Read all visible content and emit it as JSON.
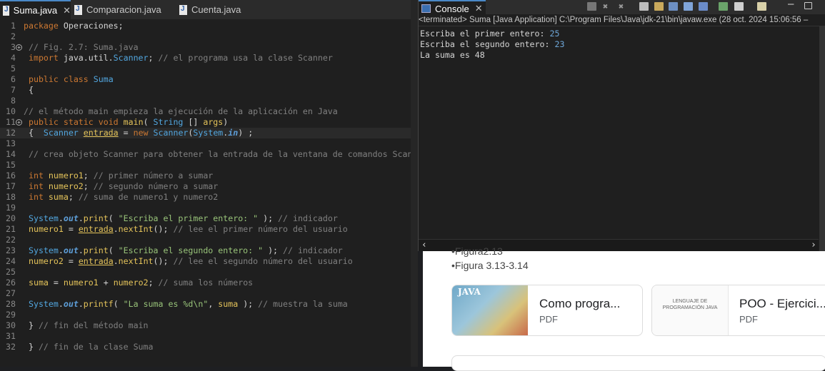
{
  "editor": {
    "tabs": [
      {
        "label": "Suma.java",
        "close": "✕",
        "active": true
      },
      {
        "label": "Comparacion.java",
        "active": false
      },
      {
        "label": "Cuenta.java",
        "active": false
      }
    ],
    "lines": [
      {
        "n": "1",
        "t": "package Operaciones;"
      },
      {
        "n": "2",
        "t": ""
      },
      {
        "n": "3",
        "t": " // Fig. 2.7: Suma.java"
      },
      {
        "n": "4",
        "t": " import java.util.Scanner; // el programa usa la clase Scanner"
      },
      {
        "n": "5",
        "t": ""
      },
      {
        "n": "6",
        "t": " public class Suma"
      },
      {
        "n": "7",
        "t": " {"
      },
      {
        "n": "8",
        "t": ""
      },
      {
        "n": "10",
        "t": "// el método main empieza la ejecución de la aplicación en Java"
      },
      {
        "n": "11",
        "t": " public static void main( String [] args)"
      },
      {
        "n": "12",
        "t": " {  Scanner entrada = new Scanner(System.in) ;"
      },
      {
        "n": "13",
        "t": ""
      },
      {
        "n": "14",
        "t": " // crea objeto Scanner para obtener la entrada de la ventana de comandos Scan"
      },
      {
        "n": "15",
        "t": ""
      },
      {
        "n": "16",
        "t": " int numero1; // primer número a sumar"
      },
      {
        "n": "17",
        "t": " int numero2; // segundo número a sumar"
      },
      {
        "n": "18",
        "t": " int suma; // suma de numero1 y numero2"
      },
      {
        "n": "19",
        "t": ""
      },
      {
        "n": "20",
        "t": " System.out.print( \"Escriba el primer entero: \" ); // indicador"
      },
      {
        "n": "21",
        "t": " numero1 = entrada.nextInt(); // lee el primer número del usuario"
      },
      {
        "n": "22",
        "t": ""
      },
      {
        "n": "23",
        "t": " System.out.print( \"Escriba el segundo entero: \" ); // indicador"
      },
      {
        "n": "24",
        "t": " numero2 = entrada.nextInt(); // lee el segundo número del usuario"
      },
      {
        "n": "25",
        "t": ""
      },
      {
        "n": "26",
        "t": " suma = numero1 + numero2; // suma los números"
      },
      {
        "n": "27",
        "t": ""
      },
      {
        "n": "28",
        "t": " System.out.printf( \"La suma es %d\\n\", suma ); // muestra la suma"
      },
      {
        "n": "29",
        "t": ""
      },
      {
        "n": "30",
        "t": " } // fin del método main"
      },
      {
        "n": "31",
        "t": ""
      },
      {
        "n": "32",
        "t": " } // fin de la clase Suma"
      }
    ]
  },
  "console": {
    "tab_label": "Console",
    "status": "<terminated> Suma [Java Application] C:\\Program Files\\Java\\jdk-21\\bin\\javaw.exe  (28 oct. 2024 15:06:56 –",
    "output": [
      {
        "text": "Escriba el primer entero: ",
        "num": "25"
      },
      {
        "text": "Escriba el segundo entero: ",
        "num": "23"
      },
      {
        "text": "La suma es 48",
        "num": ""
      }
    ]
  },
  "web": {
    "list_partial": "•Figura2.13",
    "list_item": "•Figura 3.13-3.14",
    "cards": [
      {
        "title": "Como progra...",
        "type": "PDF",
        "thumb_text": "JAVA"
      },
      {
        "title": "POO - Ejercici...",
        "type": "PDF",
        "thumb_text": "LENGUAJE DE PROGRAMACIÓN JAVA"
      }
    ]
  }
}
